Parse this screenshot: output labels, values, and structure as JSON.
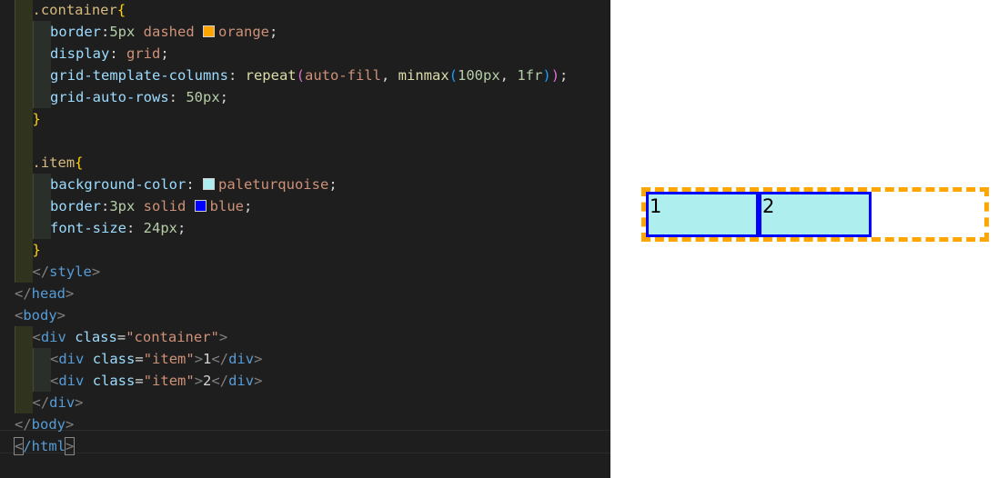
{
  "editor": {
    "lines": [
      {
        "indent": 1,
        "tokens": [
          {
            "t": ".container",
            "c": "t-sel"
          },
          {
            "t": "{",
            "c": "t-brace"
          }
        ]
      },
      {
        "indent": 2,
        "tokens": [
          {
            "t": "border",
            "c": "t-prop"
          },
          {
            "t": ":",
            "c": "t-plain"
          },
          {
            "t": "5px",
            "c": "t-num"
          },
          {
            "t": " dashed ",
            "c": "t-val"
          },
          {
            "swatch": "#ffa500"
          },
          {
            "t": "orange",
            "c": "t-val"
          },
          {
            "t": ";",
            "c": "t-plain"
          }
        ]
      },
      {
        "indent": 2,
        "tokens": [
          {
            "t": "display",
            "c": "t-prop"
          },
          {
            "t": ": ",
            "c": "t-plain"
          },
          {
            "t": "grid",
            "c": "t-val"
          },
          {
            "t": ";",
            "c": "t-plain"
          }
        ]
      },
      {
        "indent": 2,
        "tokens": [
          {
            "t": "grid-template-columns",
            "c": "t-prop"
          },
          {
            "t": ": ",
            "c": "t-plain"
          },
          {
            "t": "repeat",
            "c": "t-fn"
          },
          {
            "t": "(",
            "c": "t-paren"
          },
          {
            "t": "auto-fill",
            "c": "t-val"
          },
          {
            "t": ", ",
            "c": "t-plain"
          },
          {
            "t": "minmax",
            "c": "t-fn"
          },
          {
            "t": "(",
            "c": "t-paren2"
          },
          {
            "t": "100px",
            "c": "t-num"
          },
          {
            "t": ", ",
            "c": "t-plain"
          },
          {
            "t": "1fr",
            "c": "t-num"
          },
          {
            "t": ")",
            "c": "t-paren2"
          },
          {
            "t": ")",
            "c": "t-paren"
          },
          {
            "t": ";",
            "c": "t-plain"
          }
        ]
      },
      {
        "indent": 2,
        "tokens": [
          {
            "t": "grid-auto-rows",
            "c": "t-prop"
          },
          {
            "t": ": ",
            "c": "t-plain"
          },
          {
            "t": "50px",
            "c": "t-num"
          },
          {
            "t": ";",
            "c": "t-plain"
          }
        ]
      },
      {
        "indent": 1,
        "tokens": [
          {
            "t": "}",
            "c": "t-brace"
          }
        ]
      },
      {
        "indent": 1,
        "tokens": []
      },
      {
        "indent": 1,
        "tokens": [
          {
            "t": ".item",
            "c": "t-sel"
          },
          {
            "t": "{",
            "c": "t-brace"
          }
        ]
      },
      {
        "indent": 2,
        "tokens": [
          {
            "t": "background-color",
            "c": "t-prop"
          },
          {
            "t": ": ",
            "c": "t-plain"
          },
          {
            "swatch": "#afeeee"
          },
          {
            "t": "paleturquoise",
            "c": "t-val"
          },
          {
            "t": ";",
            "c": "t-plain"
          }
        ]
      },
      {
        "indent": 2,
        "tokens": [
          {
            "t": "border",
            "c": "t-prop"
          },
          {
            "t": ":",
            "c": "t-plain"
          },
          {
            "t": "3px",
            "c": "t-num"
          },
          {
            "t": " solid ",
            "c": "t-val"
          },
          {
            "swatch": "#0000ff"
          },
          {
            "t": "blue",
            "c": "t-val"
          },
          {
            "t": ";",
            "c": "t-plain"
          }
        ]
      },
      {
        "indent": 2,
        "tokens": [
          {
            "t": "font-size",
            "c": "t-prop"
          },
          {
            "t": ": ",
            "c": "t-plain"
          },
          {
            "t": "24px",
            "c": "t-num"
          },
          {
            "t": ";",
            "c": "t-plain"
          }
        ]
      },
      {
        "indent": 1,
        "tokens": [
          {
            "t": "}",
            "c": "t-brace"
          }
        ]
      },
      {
        "indent": 1,
        "tokens": [
          {
            "t": "</",
            "c": "t-punct"
          },
          {
            "t": "style",
            "c": "t-tag"
          },
          {
            "t": ">",
            "c": "t-punct"
          }
        ]
      },
      {
        "indent": 0,
        "tokens": [
          {
            "t": "</",
            "c": "t-punct"
          },
          {
            "t": "head",
            "c": "t-tag"
          },
          {
            "t": ">",
            "c": "t-punct"
          }
        ]
      },
      {
        "indent": 0,
        "tokens": [
          {
            "t": "<",
            "c": "t-punct"
          },
          {
            "t": "body",
            "c": "t-tag"
          },
          {
            "t": ">",
            "c": "t-punct"
          }
        ]
      },
      {
        "indent": 1,
        "tokens": [
          {
            "t": "<",
            "c": "t-punct"
          },
          {
            "t": "div",
            "c": "t-tag"
          },
          {
            "t": " ",
            "c": "t-plain"
          },
          {
            "t": "class",
            "c": "t-attr"
          },
          {
            "t": "=",
            "c": "t-plain"
          },
          {
            "t": "\"container\"",
            "c": "t-str"
          },
          {
            "t": ">",
            "c": "t-punct"
          }
        ]
      },
      {
        "indent": 2,
        "tokens": [
          {
            "t": "<",
            "c": "t-punct"
          },
          {
            "t": "div",
            "c": "t-tag"
          },
          {
            "t": " ",
            "c": "t-plain"
          },
          {
            "t": "class",
            "c": "t-attr"
          },
          {
            "t": "=",
            "c": "t-plain"
          },
          {
            "t": "\"item\"",
            "c": "t-str"
          },
          {
            "t": ">",
            "c": "t-punct"
          },
          {
            "t": "1",
            "c": "t-plain"
          },
          {
            "t": "</",
            "c": "t-punct"
          },
          {
            "t": "div",
            "c": "t-tag"
          },
          {
            "t": ">",
            "c": "t-punct"
          }
        ]
      },
      {
        "indent": 2,
        "tokens": [
          {
            "t": "<",
            "c": "t-punct"
          },
          {
            "t": "div",
            "c": "t-tag"
          },
          {
            "t": " ",
            "c": "t-plain"
          },
          {
            "t": "class",
            "c": "t-attr"
          },
          {
            "t": "=",
            "c": "t-plain"
          },
          {
            "t": "\"item\"",
            "c": "t-str"
          },
          {
            "t": ">",
            "c": "t-punct"
          },
          {
            "t": "2",
            "c": "t-plain"
          },
          {
            "t": "</",
            "c": "t-punct"
          },
          {
            "t": "div",
            "c": "t-tag"
          },
          {
            "t": ">",
            "c": "t-punct"
          }
        ]
      },
      {
        "indent": 1,
        "tokens": [
          {
            "t": "</",
            "c": "t-punct"
          },
          {
            "t": "div",
            "c": "t-tag"
          },
          {
            "t": ">",
            "c": "t-punct"
          }
        ]
      },
      {
        "indent": 0,
        "tokens": [
          {
            "t": "</",
            "c": "t-punct"
          },
          {
            "t": "body",
            "c": "t-tag"
          },
          {
            "t": ">",
            "c": "t-punct"
          }
        ]
      },
      {
        "indent": 0,
        "cursor": true,
        "tokens": [
          {
            "t": "<",
            "c": "t-punct",
            "box": true
          },
          {
            "t": "/html",
            "c": "t-tag"
          },
          {
            "t": ">",
            "c": "t-punct",
            "box": true
          }
        ]
      }
    ]
  },
  "preview": {
    "container_border_color": "#ffa500",
    "item_bg_color": "#afeeee",
    "item_border_color": "#0000ff",
    "items": [
      "1",
      "2"
    ]
  }
}
